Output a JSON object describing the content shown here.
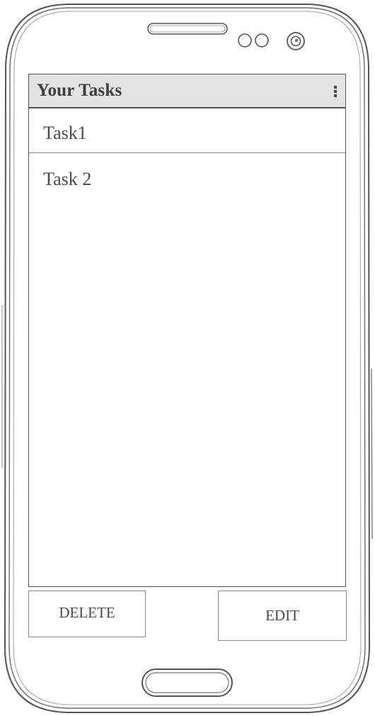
{
  "app_bar": {
    "title": "Your Tasks",
    "overflow_icon": "more-vert-icon"
  },
  "tasks": [
    {
      "label": "Task1"
    },
    {
      "label": "Task 2"
    }
  ],
  "actions": {
    "delete_label": "DELETE",
    "edit_label": "EDIT"
  },
  "device": {
    "speaker_icon": "earpiece-speaker",
    "sensor_icon": "proximity-sensors",
    "camera_icon": "front-camera",
    "home_button_icon": "home-button"
  },
  "colors": {
    "app_bar_background": "#e3e3e3",
    "outline": "#555555",
    "text": "#4a4a4a"
  }
}
